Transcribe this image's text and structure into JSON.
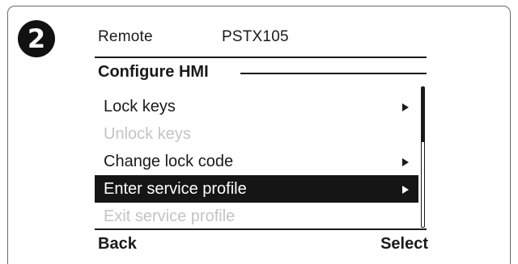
{
  "step": "2",
  "status": {
    "label": "Remote",
    "device": "PSTX105"
  },
  "screen_title": "Configure HMI",
  "menu": [
    {
      "label": "Lock keys",
      "has_submenu": true,
      "enabled": true,
      "selected": false
    },
    {
      "label": "Unlock keys",
      "has_submenu": false,
      "enabled": false,
      "selected": false
    },
    {
      "label": "Change lock code",
      "has_submenu": true,
      "enabled": true,
      "selected": false
    },
    {
      "label": "Enter service profile",
      "has_submenu": true,
      "enabled": true,
      "selected": true
    },
    {
      "label": "Exit service profile",
      "has_submenu": false,
      "enabled": false,
      "selected": false
    }
  ],
  "softkeys": {
    "left": "Back",
    "right": "Select"
  },
  "colors": {
    "highlight": "#151515",
    "text": "#1a1a1a",
    "disabled": "#c4c4c4"
  }
}
